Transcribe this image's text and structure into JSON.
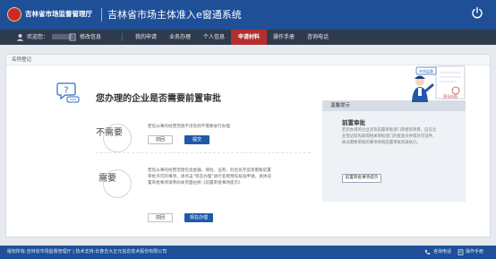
{
  "header": {
    "logo_text": "吉林省市场监督管理厅",
    "system_title": "吉林省市场主体准入e窗通系统",
    "bg_color": "#1e4f97"
  },
  "nav": {
    "welcome": "欢迎您：",
    "edit_info": "修改信息",
    "items": [
      {
        "label": "我的申请",
        "active": false
      },
      {
        "label": "业务办理",
        "active": false
      },
      {
        "label": "个人信息",
        "active": false
      },
      {
        "label": "申请材料",
        "active": true
      },
      {
        "label": "操作手册",
        "active": false
      },
      {
        "label": "咨询电话",
        "active": false
      }
    ],
    "active_color": "#b32f2f"
  },
  "panel": {
    "breadcrumb": "名称登记",
    "question": "您办理的企业是否需要前置审批",
    "option_no": {
      "label": "不需要",
      "desc": "若您从事的经营范围不涉及到不需要进行办理",
      "back": "前回",
      "submit": "提交"
    },
    "option_yes": {
      "label": "需要",
      "desc": "若您从事的经营范围包含金融、保险、证券、危险化学品等需要前置审批许可的事项，请点击“现在办理”进行名称预先核准申请。具体前置审批事项请参阅本页面右侧《前置审批事项提示》",
      "back": "前回",
      "process": "现在办理"
    }
  },
  "hint": {
    "header": "温馨提示",
    "title": "前置审批",
    "body": "若您办理的企业涉及前置审批部门审批的项目，应在企业登记前先取得相关审批部门的批准文件或许可证件，依法需要审批的事项参照前置审批目录执行。",
    "button": "前置审批事项提示"
  },
  "illustration": {
    "sign_text": "市场监督",
    "badge_text": "营业执照"
  },
  "footer": {
    "copyright": "版权所有:吉林省市场监督管理厅 | 技术支持:长春吉大正元信息技术股份有限公司",
    "hotline": "咨询电话",
    "manual": "操作手册"
  }
}
